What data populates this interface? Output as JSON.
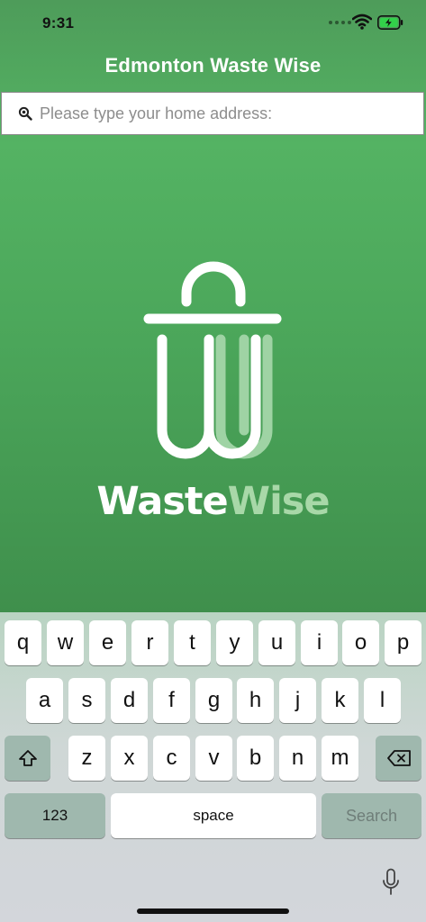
{
  "status_bar": {
    "time": "9:31"
  },
  "header": {
    "title": "Edmonton Waste Wise"
  },
  "search": {
    "placeholder": "Please type your home address:"
  },
  "logo": {
    "word_a": "Waste",
    "word_b": "Wise"
  },
  "keyboard": {
    "row1": [
      "q",
      "w",
      "e",
      "r",
      "t",
      "y",
      "u",
      "i",
      "o",
      "p"
    ],
    "row2": [
      "a",
      "s",
      "d",
      "f",
      "g",
      "h",
      "j",
      "k",
      "l"
    ],
    "row3": [
      "z",
      "x",
      "c",
      "v",
      "b",
      "n",
      "m"
    ],
    "numbers_label": "123",
    "space_label": "space",
    "search_label": "Search"
  },
  "colors": {
    "brand_green": "#4ba65a",
    "logo_light_green": "#a8d8a8",
    "keyboard_function_key": "#9fb8ae"
  }
}
